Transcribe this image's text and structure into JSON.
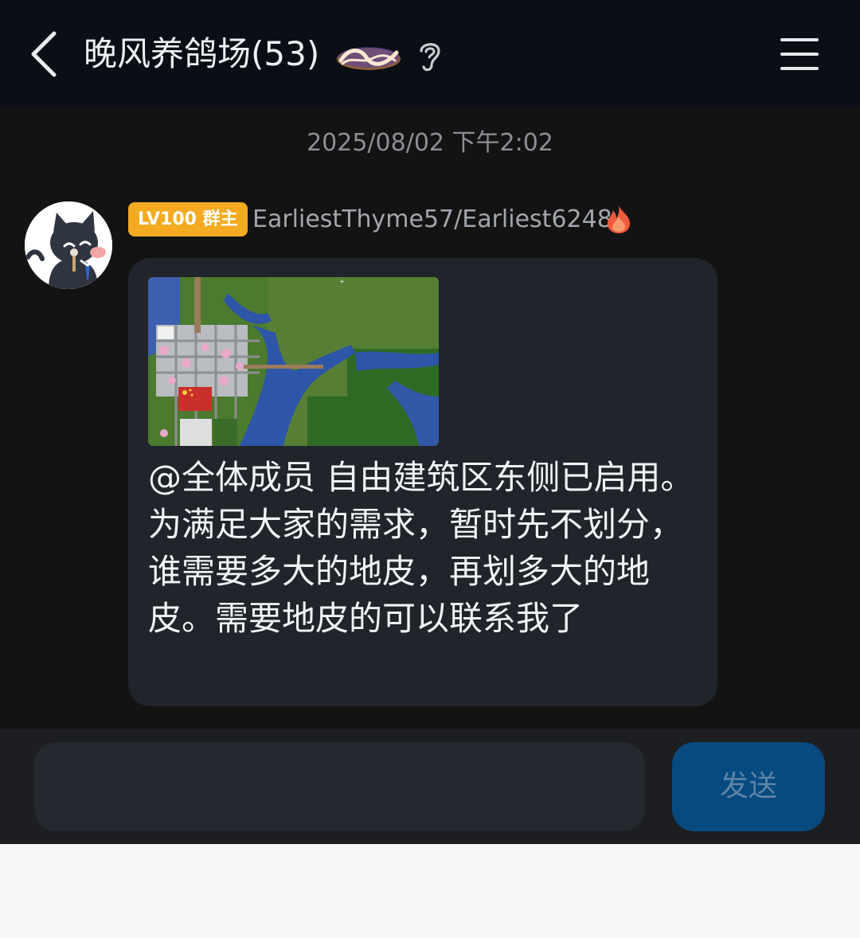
{
  "header": {
    "title": "晚风养鸽场(53)",
    "logo_text": "Que sera",
    "back_icon": "chevron-left-icon",
    "ear_icon": "ear-icon",
    "menu_icon": "hamburger-menu-icon"
  },
  "chat": {
    "timestamp": "2025/08/02 下午2:02",
    "message": {
      "level_badge": "LV100 群主",
      "username": "EarliestThyme57/Earliest6248",
      "flame_icon": "fire-icon",
      "image": "minecraft-map-screenshot",
      "text": "@全体成员 自由建筑区东侧已启用。为满足大家的需求，暂时先不划分，谁需要多大的地皮，再划多大的地皮。需要地皮的可以联系我了"
    }
  },
  "composer": {
    "input_value": "",
    "send_label": "发送"
  },
  "colors": {
    "background": "#131313",
    "header": "#0b0e14",
    "bubble": "#20242b",
    "badge": "#f4ab22",
    "send_button": "#074a80"
  }
}
